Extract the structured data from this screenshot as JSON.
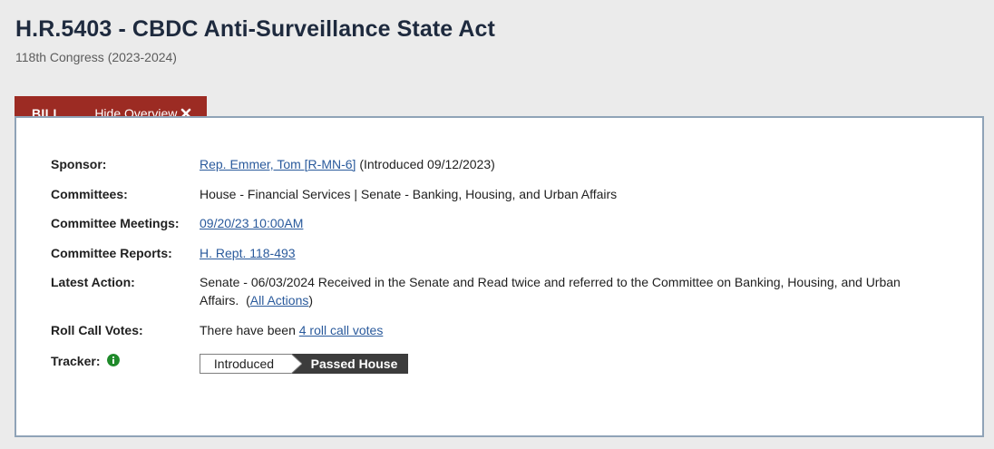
{
  "header": {
    "title": "H.R.5403 - CBDC Anti-Surveillance State Act",
    "congress": "118th Congress (2023-2024)"
  },
  "tabs": {
    "bill_label": "BILL",
    "hide_overview_label": "Hide Overview"
  },
  "overview": {
    "sponsor_label": "Sponsor:",
    "sponsor_link": "Rep. Emmer, Tom [R-MN-6]",
    "sponsor_suffix": " (Introduced 09/12/2023)",
    "committees_label": "Committees:",
    "committees_value": "House - Financial Services | Senate - Banking, Housing, and Urban Affairs",
    "meetings_label": "Committee Meetings:",
    "meetings_link": "09/20/23 10:00AM",
    "reports_label": "Committee Reports:",
    "reports_link": "H. Rept. 118-493",
    "latest_label": "Latest Action:",
    "latest_text": "Senate - 06/03/2024 Received in the Senate and Read twice and referred to the Committee on Banking, Housing, and Urban Affairs.",
    "latest_open": "  (",
    "all_actions_link": "All Actions",
    "latest_close": ")",
    "roll_label": "Roll Call Votes:",
    "roll_prefix": "There have been ",
    "roll_link": "4 roll call votes",
    "tracker_label": "Tracker:",
    "tracker_steps": [
      "Introduced",
      "Passed House"
    ],
    "tracker_current": "Passed House"
  },
  "colors": {
    "tab_red": "#9c2b23",
    "link_blue": "#2a5a9c",
    "info_green": "#1f8a2a",
    "tracker_active": "#3c3c3c"
  }
}
